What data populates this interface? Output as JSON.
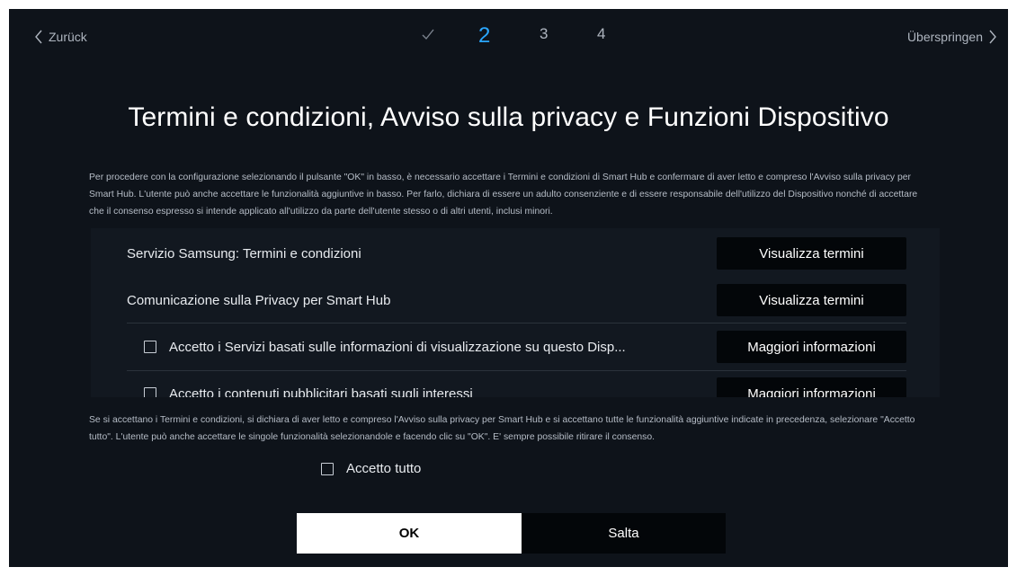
{
  "nav": {
    "back_label": "Zurück",
    "skip_label": "Überspringen",
    "steps": [
      "2",
      "3",
      "4"
    ],
    "active_step": "2"
  },
  "title": "Termini e condizioni, Avviso sulla privacy e Funzioni Dispositivo",
  "intro_text": "Per procedere con la configurazione selezionando il pulsante \"OK\" in basso, è necessario accettare i Termini e condizioni di Smart Hub e confermare di aver letto e compreso l'Avviso sulla privacy per Smart Hub. L'utente può anche accettare le funzionalità aggiuntive in basso. Per farlo, dichiara di essere un adulto consenziente e di essere responsabile dell'utilizzo del Dispositivo nonché di accettare che il consenso espresso si intende applicato all'utilizzo da parte dell'utente stesso o di altri utenti, inclusi minori.",
  "panel": {
    "items": [
      {
        "label": "Servizio Samsung: Termini e condizioni",
        "button": "Visualizza termini"
      },
      {
        "label": "Comunicazione sulla Privacy per Smart Hub",
        "button": "Visualizza termini"
      },
      {
        "label": "Accetto i Servizi basati sulle informazioni di visualizzazione su questo Disp...",
        "button": "Maggiori informazioni",
        "checked": false
      },
      {
        "label": "Accetto i contenuti pubblicitari basati sugli interessi",
        "button": "Maggiori informazioni",
        "checked": false
      }
    ]
  },
  "outro_text": "Se si accettano i Termini e condizioni, si dichiara di aver letto e compreso l'Avviso sulla privacy per Smart Hub e si accettano tutte le funzionalità aggiuntive indicate in precedenza, selezionare \"Accetto tutto\". L'utente può anche accettare le singole funzionalità selezionandole e facendo clic su \"OK\". E' sempre possibile ritirare il consenso.",
  "accept_all": {
    "label": "Accetto tutto",
    "checked": false
  },
  "buttons": {
    "ok": "OK",
    "skip": "Salta"
  },
  "colors": {
    "background": "#0e131a",
    "accent": "#2aa7ff",
    "button_dark": "#030609"
  }
}
